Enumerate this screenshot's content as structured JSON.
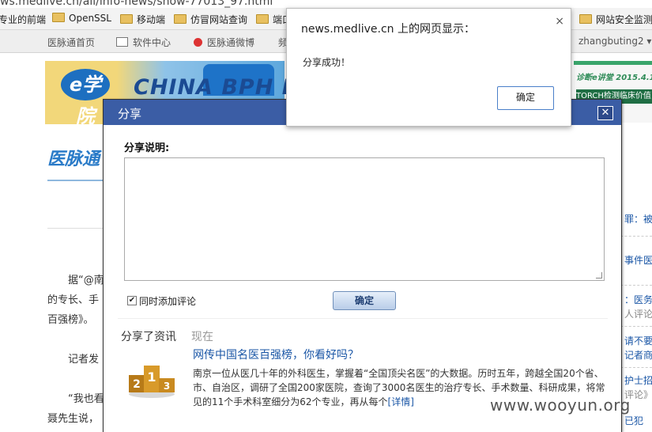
{
  "browser": {
    "url_fragment": "ws.medlive.cn/all/info-news/show-77013_97.html",
    "bookmarks": [
      "专业的前端",
      "OpenSSL",
      "移动端",
      "仿冒网站查询",
      "端口",
      "网站安全监测"
    ]
  },
  "sitebar": {
    "items": [
      "医脉通首页",
      "软件中心",
      "医脉通微博",
      "频"
    ],
    "user": "zhangbuting2"
  },
  "background": {
    "banner_text": "CHINA BPH DI",
    "banner_logo": "e学院",
    "left_logo": "医脉通",
    "body_lines": [
      "据“@南",
      "的专长、手",
      "百强榜》。",
      "记者发",
      "“我也看",
      "聂先生说，"
    ],
    "right_ad": {
      "line1": "诊断e讲堂 2015.4.15",
      "line2": "TORCH检测临床价值 保健院"
    },
    "right_snippets": [
      "罪：被",
      "事件医",
      "：医务",
      "人评论",
      "请不要",
      "记者商",
      "护士招",
      "评论》",
      "已犯"
    ]
  },
  "watermark": "www.wooyun.org",
  "share_dialog": {
    "title": "分享",
    "close_label": "✕",
    "desc_label": "分享说明:",
    "textarea_value": "",
    "checkbox_checked": true,
    "checkbox_mark": "✔",
    "checkbox_label": "同时添加评论",
    "confirm_label": "确定",
    "tab_shared": "分享了资讯",
    "tab_now": "现在",
    "article": {
      "title": "网传中国名医百强榜，你看好吗？",
      "desc": "南京一位从医几十年的外科医生，掌握着“全国顶尖名医”的大数据。历时五年，跨越全国20个省、市、自治区，调研了全国200家医院，查询了3000名医生的治疗专长、手术数量、科研成果，将常见的11个手术科室细分为62个专业，再从每个",
      "more": "[详情]",
      "image_icon": "podium-123-icon"
    }
  },
  "alert": {
    "title": "news.medlive.cn 上的网页显示：",
    "close": "×",
    "message": "分享成功！",
    "ok_label": "确定"
  }
}
